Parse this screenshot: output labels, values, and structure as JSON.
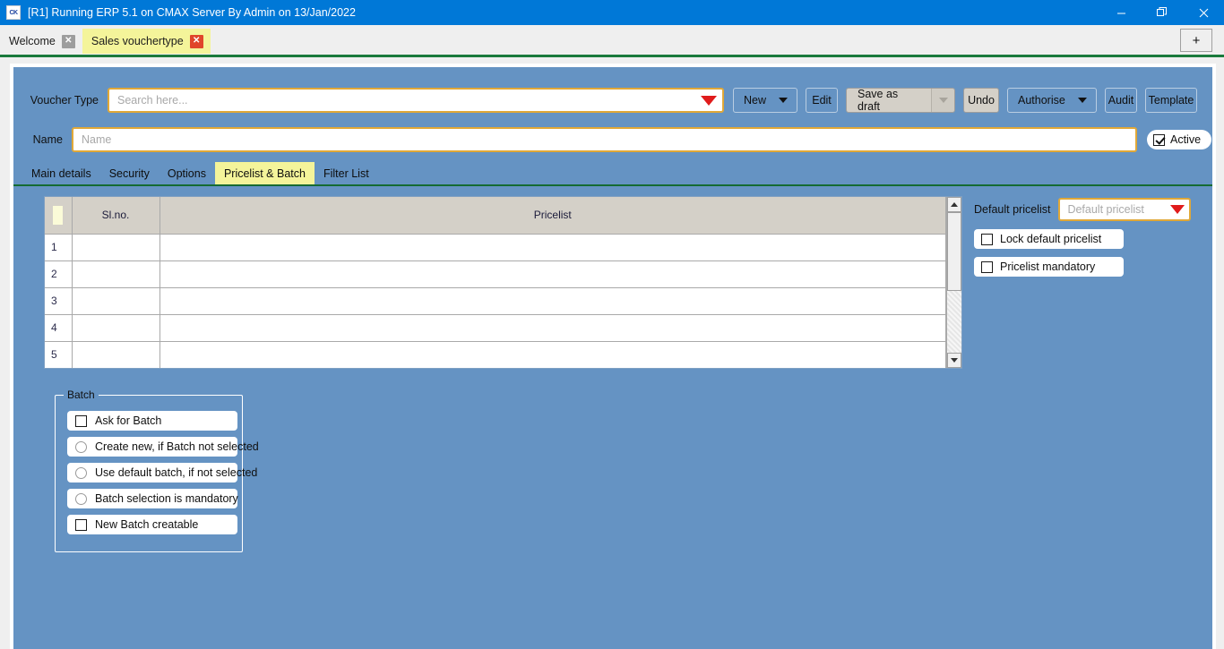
{
  "window": {
    "title": "[R1] Running ERP 5.1 on CMAX Server By Admin on 13/Jan/2022",
    "app_icon": "CK",
    "minimize": "—",
    "restore": "❐",
    "close": "✕",
    "accent_color": "#0078d7"
  },
  "document_tabs": {
    "items": [
      {
        "label": "Welcome",
        "close": "✕",
        "active": false
      },
      {
        "label": "Sales vouchertype",
        "close": "✕",
        "active": true
      }
    ],
    "add_tab_label": "+",
    "active_tab_color": "#f4f49a",
    "underline_color": "#1a7a3c"
  },
  "form": {
    "voucher_type": {
      "label": "Voucher Type",
      "placeholder": "Search here...",
      "value": "",
      "dropdown_icon": "caret-down-red"
    },
    "name": {
      "label": "Name",
      "placeholder": "Name",
      "value": ""
    },
    "active": {
      "label": "Active",
      "checked": true
    }
  },
  "toolbar": {
    "new_label": "New",
    "edit_label": "Edit",
    "save_as_draft_label": "Save as draft",
    "undo_label": "Undo",
    "authorise_label": "Authorise",
    "audit_label": "Audit",
    "template_label": "Template"
  },
  "section_tabs": {
    "items": [
      {
        "label": "Main details",
        "active": false
      },
      {
        "label": "Security",
        "active": false
      },
      {
        "label": "Options",
        "active": false
      },
      {
        "label": "Pricelist & Batch",
        "active": true
      },
      {
        "label": "Filter List",
        "active": false
      }
    ]
  },
  "pricelist_grid": {
    "columns": [
      "",
      "Sl.no.",
      "Pricelist"
    ],
    "rows": [
      {
        "num": "1",
        "sl": "",
        "pricelist": ""
      },
      {
        "num": "2",
        "sl": "",
        "pricelist": ""
      },
      {
        "num": "3",
        "sl": "",
        "pricelist": ""
      },
      {
        "num": "4",
        "sl": "",
        "pricelist": ""
      },
      {
        "num": "5",
        "sl": "",
        "pricelist": ""
      }
    ],
    "scroll_up": "▲",
    "scroll_down": "▼"
  },
  "pricelist_options": {
    "default_pricelist_label": "Default pricelist",
    "default_pricelist_placeholder": "Default pricelist",
    "default_pricelist_value": "",
    "lock_default_pricelist": {
      "label": "Lock default pricelist",
      "checked": false
    },
    "pricelist_mandatory": {
      "label": "Pricelist  mandatory",
      "checked": false
    }
  },
  "batch": {
    "legend": "Batch",
    "items": [
      {
        "label": "Ask for Batch",
        "type": "checkbox",
        "checked": false
      },
      {
        "label": "Create new, if Batch not selected",
        "type": "radio",
        "checked": false
      },
      {
        "label": "Use default batch, if not selected",
        "type": "radio",
        "checked": false
      },
      {
        "label": "Batch selection is mandatory",
        "type": "radio",
        "checked": false
      },
      {
        "label": "New Batch creatable",
        "type": "checkbox",
        "checked": false
      }
    ]
  },
  "theme": {
    "panel_background": "#6593c3",
    "field_border": "#e0a838",
    "dropdown_red": "#e01b1b"
  }
}
